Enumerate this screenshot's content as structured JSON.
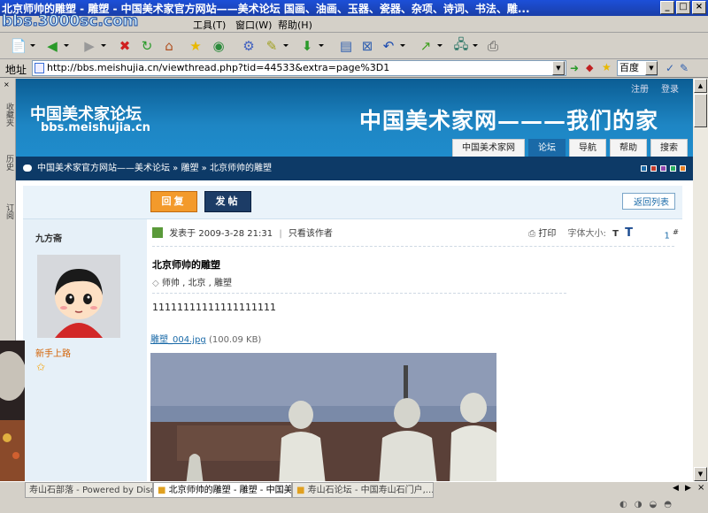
{
  "window": {
    "title": "北京师帅的雕塑 - 雕塑 - 中国美术家官方网站——美术论坛 国画、油画、玉器、瓷器、杂项、诗词、书法、雕...",
    "controls": [
      "_",
      "□",
      "×"
    ]
  },
  "overlay_logo": "bbs.3000sc.com",
  "menu": [
    "工具(T)",
    "窗口(W)",
    "帮助(H)"
  ],
  "address": {
    "label": "地址",
    "url": "http://bbs.meishujia.cn/viewthread.php?tid=44533&extra=page%3D1",
    "search_engine": "百度"
  },
  "sidebar": {
    "tabs": [
      "收藏夹",
      "历史",
      "订阅"
    ]
  },
  "site": {
    "header_links": [
      "注册",
      "登录"
    ],
    "brand_cn": "中国美术家论坛",
    "brand_en": "bbs.meishujia.cn",
    "slogan": "中国美术家网———我们的家",
    "nav_tabs": [
      {
        "label": "中国美术家网",
        "active": false
      },
      {
        "label": "论坛",
        "active": true
      },
      {
        "label": "导航",
        "active": false
      },
      {
        "label": "帮助",
        "active": false
      },
      {
        "label": "搜索",
        "active": false
      }
    ],
    "breadcrumb": "中国美术家官方网站——美术论坛 » 雕塑 » 北京师帅的雕塑",
    "swatch_colors": [
      "#1a6aa8",
      "#c0392b",
      "#8e44ad",
      "#27ae60",
      "#e67e22"
    ]
  },
  "thread": {
    "reply_label": "回复",
    "post_label": "发帖",
    "back_label": "返回列表",
    "author": "九方斋",
    "rank": "新手上路",
    "posted_at": "发表于 2009-3-28 21:31",
    "only_author": "只看该作者",
    "print": "打印",
    "font_size_label": "字体大小:",
    "font_small": "T",
    "font_large": "T",
    "floor": "1",
    "floor_suffix": "#",
    "title": "北京师帅的雕塑",
    "tags": [
      "师帅",
      "北京",
      "雕塑"
    ],
    "body": "11111111111111111111",
    "attachment_name": "雕塑_004.jpg",
    "attachment_size": "(100.09 KB)"
  },
  "taskbar": [
    {
      "label": "寿山石部落 - Powered by Disc...",
      "active": false
    },
    {
      "label": "北京师帅的雕塑 - 雕塑 - 中国美...",
      "active": true
    },
    {
      "label": "寿山石论坛 - 中国寿山石门户,...",
      "active": false
    }
  ]
}
